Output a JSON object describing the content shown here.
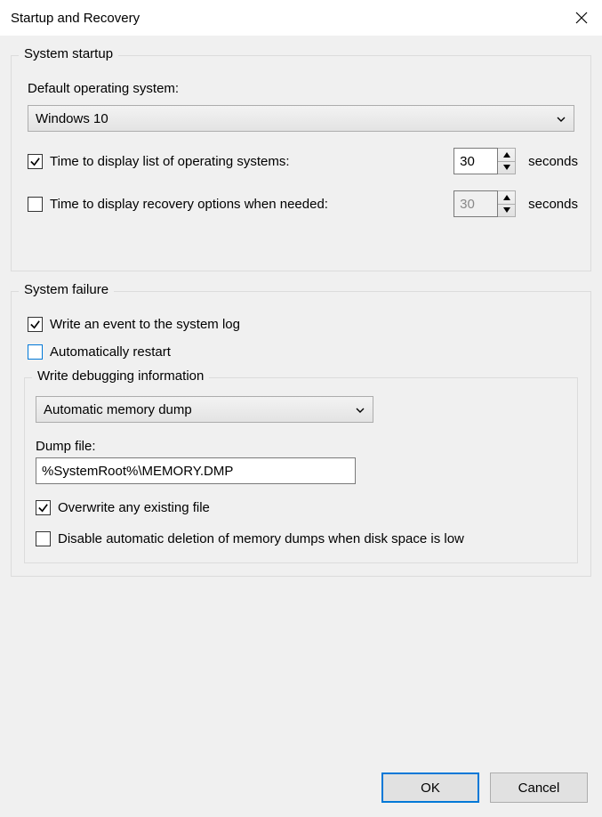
{
  "title": "Startup and Recovery",
  "startup": {
    "legend": "System startup",
    "default_os_label": "Default operating system:",
    "default_os_value": "Windows 10",
    "time_display_list": {
      "checked": true,
      "label": "Time to display list of operating systems:",
      "value": "30",
      "unit": "seconds"
    },
    "time_display_recovery": {
      "checked": false,
      "label": "Time to display recovery options when needed:",
      "value": "30",
      "unit": "seconds"
    }
  },
  "failure": {
    "legend": "System failure",
    "write_event": {
      "checked": true,
      "label": "Write an event to the system log"
    },
    "auto_restart": {
      "checked": false,
      "label": "Automatically restart"
    },
    "debug": {
      "legend": "Write debugging information",
      "dump_type": "Automatic memory dump",
      "dump_file_label": "Dump file:",
      "dump_file_value": "%SystemRoot%\\MEMORY.DMP",
      "overwrite": {
        "checked": true,
        "label": "Overwrite any existing file"
      },
      "disable_delete": {
        "checked": false,
        "label": "Disable automatic deletion of memory dumps when disk space is low"
      }
    }
  },
  "buttons": {
    "ok": "OK",
    "cancel": "Cancel"
  }
}
